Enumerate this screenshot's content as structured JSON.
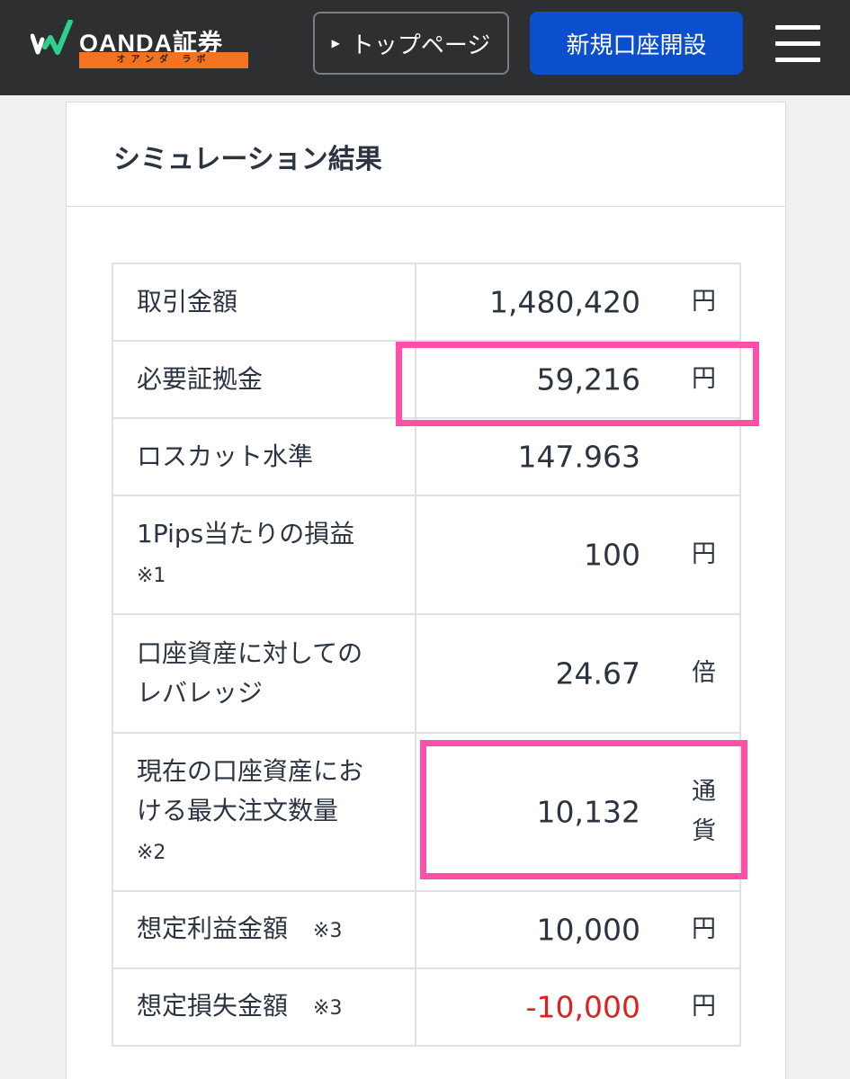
{
  "header": {
    "logo_text": "OANDA証券",
    "logo_sub": "オアンダ ラボ",
    "top_page_label": "トップページ",
    "open_account_label": "新規口座開設",
    "menu_icon": "hamburger-menu-icon"
  },
  "card": {
    "title": "シミュレーション結果"
  },
  "rows": [
    {
      "label": "取引金額",
      "value": "1,480,420",
      "unit": "円"
    },
    {
      "label": "必要証拠金",
      "value": "59,216",
      "unit": "円"
    },
    {
      "label": "ロスカット水準",
      "value": "147.963",
      "unit": ""
    },
    {
      "label": "1Pips当たりの損益",
      "note": "※1",
      "value": "100",
      "unit": "円"
    },
    {
      "label": "口座資産に対しての",
      "label2": "レバレッジ",
      "value": "24.67",
      "unit": "倍"
    },
    {
      "label": "現在の口座資産にお",
      "label2": "ける最大注文数量",
      "note": "※2",
      "value": "10,132",
      "unit": "通",
      "unit2": "貨"
    },
    {
      "label": "想定利益金額",
      "note": "※3",
      "value": "10,000",
      "unit": "円"
    },
    {
      "label": "想定損失金額",
      "note": "※3",
      "value": "-10,000",
      "unit": "円"
    }
  ],
  "colors": {
    "header_bg": "#2d2f31",
    "primary_button": "#0b4fce",
    "logo_orange": "#f37321",
    "highlight": "#ff4fa9",
    "negative": "#e02020"
  }
}
